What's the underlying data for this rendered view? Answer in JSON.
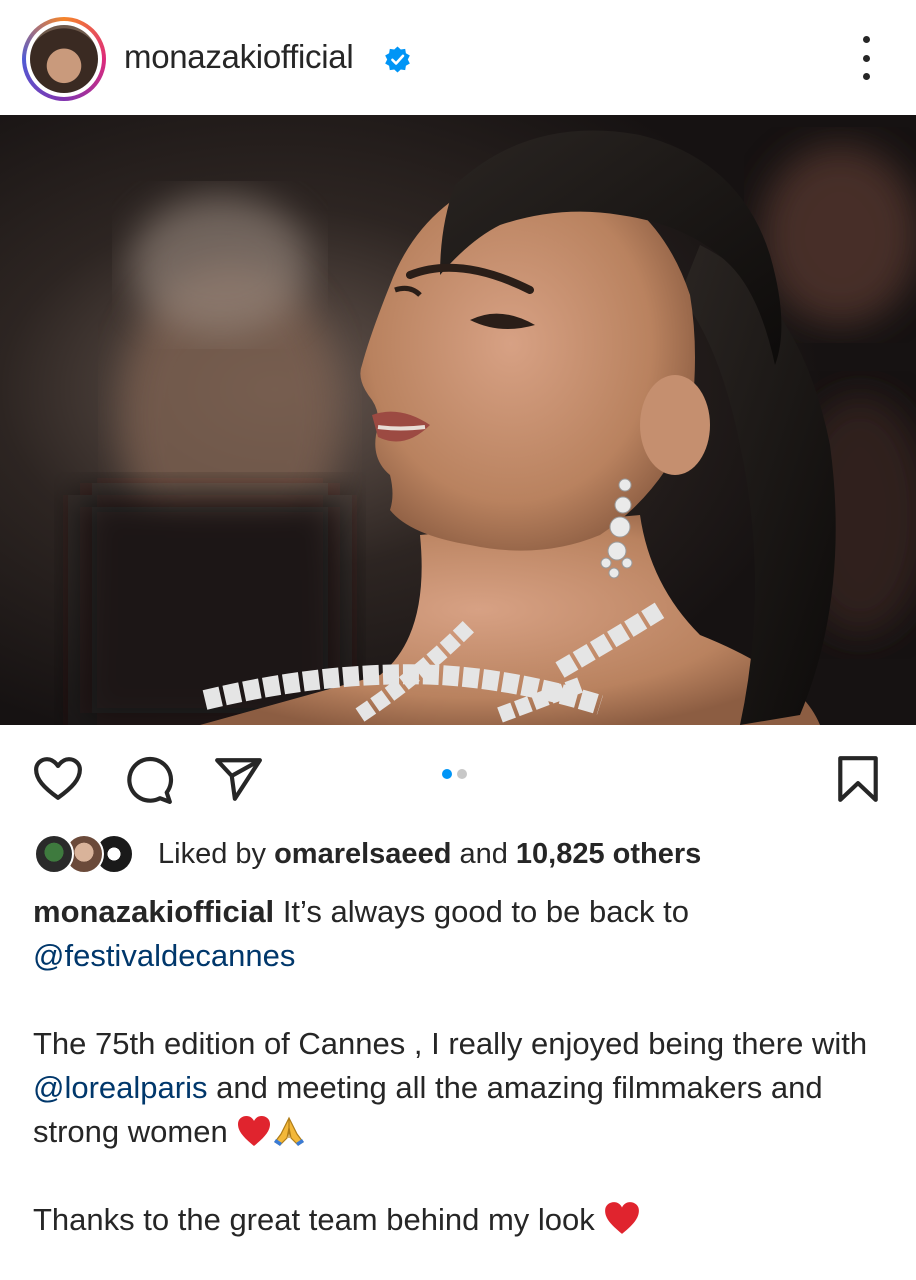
{
  "header": {
    "username": "monazakiofficial"
  },
  "post": {
    "image_alt": "Woman with sleek ponytail wearing sparkling crystal earrings and necklace at a red carpet event",
    "carousel_current": 1,
    "carousel_total": 2
  },
  "likes": {
    "prefix": "Liked by",
    "liker": "omarelsaeed",
    "middle": "and",
    "count_text": "10,825 others"
  },
  "caption": {
    "username": "monazakiofficial",
    "line1": "It’s always good to be back to",
    "mention1": "@festivaldecannes",
    "p2_part1": "The 75th edition of Cannes , I really enjoyed being there with",
    "mention2": "@lorealparis",
    "p2_part2": "and meeting all the amazing filmmakers and strong women",
    "p3": "Thanks to the great team behind my look"
  },
  "colors": {
    "text": "#262626",
    "mention": "#00376b",
    "verified": "#0095f6",
    "pager_active": "#0095f6",
    "pager_inactive": "#c7c7c7",
    "heart_emoji": "#e0242e",
    "praying_emoji": "#f3b83a"
  },
  "icons": [
    "verified-badge-icon",
    "more-options-icon",
    "heart-icon",
    "comment-icon",
    "share-icon",
    "bookmark-icon",
    "heart-emoji-icon",
    "praying-hands-emoji-icon"
  ]
}
